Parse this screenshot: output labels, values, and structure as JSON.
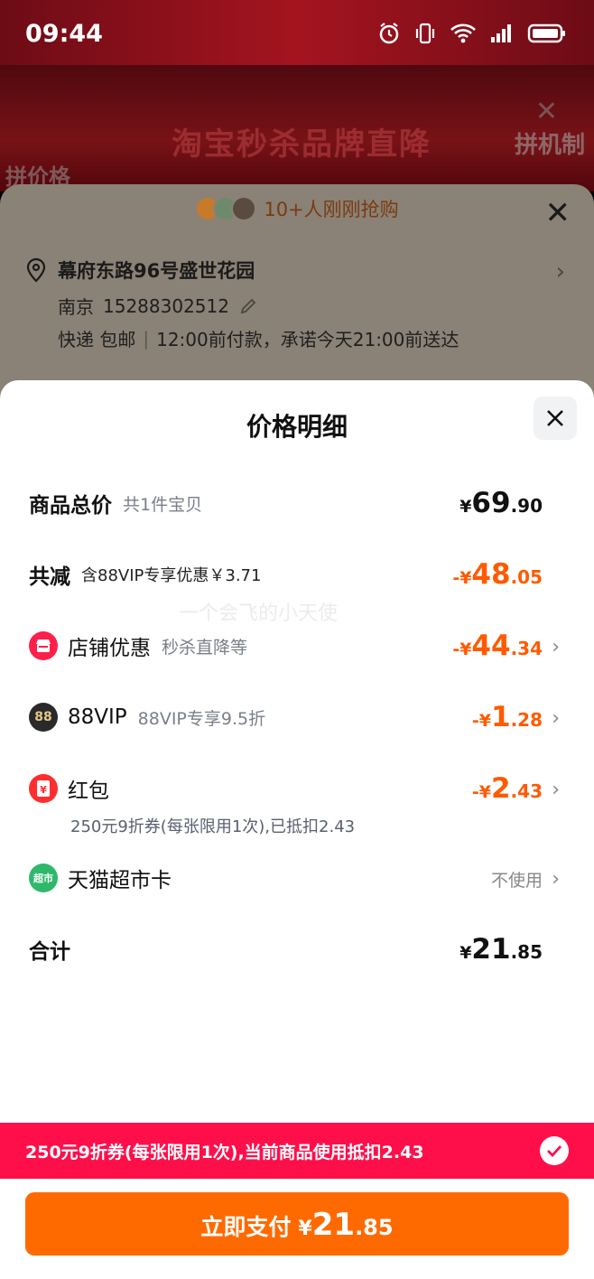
{
  "status_bar": {
    "time": "09:44",
    "icons": [
      "alarm-icon",
      "vibrate-icon",
      "wifi-icon",
      "signal-icon",
      "battery-icon"
    ]
  },
  "background": {
    "banner_main": "淘宝秒杀品牌直降",
    "banner_right": "拼机制",
    "banner_left": "拼价格"
  },
  "order": {
    "buyers_text": "10+人刚刚抢购",
    "address": "幕府东路96号盛世花园",
    "city": "南京",
    "phone": "15288302512",
    "shipping_method": "快递 包邮",
    "delivery_promise": "12:00前付款，承诺今天21:00前送达"
  },
  "modal": {
    "title": "价格明细",
    "watermark": "一个会飞的小天使",
    "goods_total": {
      "label": "商品总价",
      "sub": "共1件宝贝",
      "currency": "¥",
      "int": "69",
      "dec": ".90"
    },
    "total_reduce": {
      "label": "共减",
      "sub": "含88VIP专享优惠￥3.71",
      "currency": "-¥",
      "int": "48",
      "dec": ".05"
    },
    "shop_discount": {
      "label": "店铺优惠",
      "sub": "秒杀直降等",
      "currency": "-¥",
      "int": "44",
      "dec": ".34"
    },
    "vip": {
      "icon_text": "88",
      "label": "88VIP",
      "sub": "88VIP专享9.5折",
      "currency": "-¥",
      "int": "1",
      "dec": ".28"
    },
    "red_packet": {
      "icon_text": "¥",
      "label": "红包",
      "desc": "250元9折券(每张限用1次),已抵扣2.43",
      "currency": "-¥",
      "int": "2",
      "dec": ".43"
    },
    "tmall_card": {
      "icon_text": "超市",
      "label": "天猫超市卡",
      "status": "不使用"
    },
    "total": {
      "label": "合计",
      "currency": "¥",
      "int": "21",
      "dec": ".85"
    }
  },
  "coupon_bar": {
    "text": "250元9折券(每张限用1次),当前商品使用抵扣2.43"
  },
  "pay": {
    "label": "立即支付",
    "currency": "¥",
    "int": "21",
    "dec": ".85"
  },
  "colors": {
    "discount_orange": "#ff5a00",
    "coupon_red": "#ff0f4a",
    "pay_orange": "#ff6a00"
  }
}
